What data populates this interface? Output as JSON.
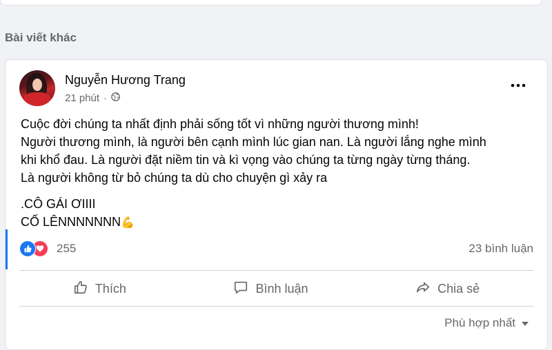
{
  "section": {
    "label": "Bài viết khác"
  },
  "post": {
    "author": "Nguyễn Hương Trang",
    "time": "21 phút",
    "separator": "·",
    "lines": [
      "Cuộc đời chúng ta nhất định phải sống tốt vì những người thương mình!",
      "Người thương mình, là người bên cạnh mình lúc gian nan. Là người lắng nghe mình",
      "khi khổ đau. Là người đặt niềm tin và kì vọng vào chúng ta từng ngày từng tháng.",
      "Là người không từ bỏ chúng ta dù cho chuyện gì xảy ra"
    ],
    "line_cheer_1": ".CÔ GÁI ƠIIII",
    "line_cheer_2": "CỐ LÊNNNNNNN",
    "emoji": "💪",
    "reaction_count": "255",
    "comments_count": "23 bình luận"
  },
  "actions": {
    "like": "Thích",
    "comment": "Bình luận",
    "share": "Chia sẻ"
  },
  "sort": {
    "label": "Phù hợp nhất"
  },
  "icons": {
    "privacy": "globe-icon",
    "more": "more-options-icon",
    "like": "thumbs-up-icon",
    "comment": "comment-icon",
    "share": "share-icon",
    "sort": "caret-down-icon"
  },
  "colors": {
    "like_blue": "#1877f2",
    "love_red": "#f33e58",
    "secondary_text": "#65676b"
  }
}
